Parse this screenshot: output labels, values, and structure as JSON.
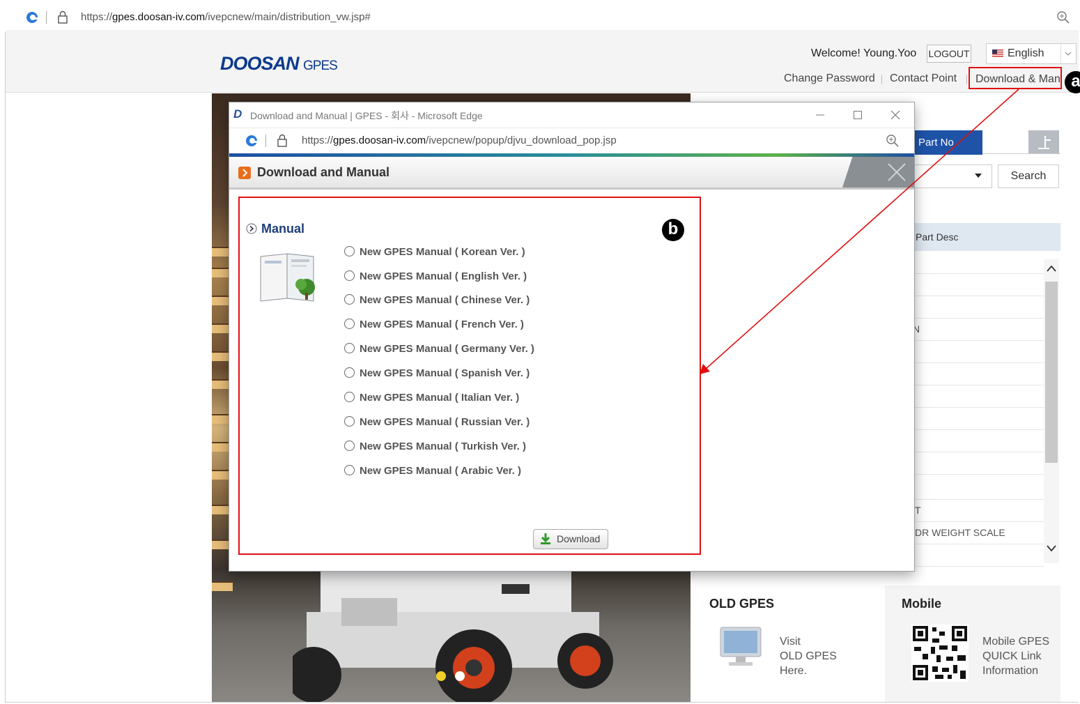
{
  "browser": {
    "url_prefix": "https://",
    "url_host": "gpes.doosan-iv.com",
    "url_path": "/ivepcnew/main/distribution_vw.jsp#"
  },
  "header": {
    "logo_main": "DOOSAN",
    "logo_sub": "GPES",
    "welcome": "Welcome! Young.Yoo",
    "logout": "LOGOUT",
    "language": "English",
    "change_password": "Change Password",
    "contact_point": "Contact Point",
    "download_manual": "Download & Man"
  },
  "right_panel": {
    "tab_part_no": "Part No",
    "search_button": "Search",
    "col_part_desc": "Part Desc",
    "row_fragments": [
      "N",
      "T",
      "DR WEIGHT SCALE"
    ],
    "old_gpes_title": "OLD GPES",
    "old_gpes_text": [
      "Visit",
      "OLD GPES",
      "Here."
    ],
    "mobile_title": "Mobile",
    "mobile_text": [
      "Mobile GPES",
      "QUICK Link",
      "Information"
    ]
  },
  "popup": {
    "window_title": "Download and Manual | GPES - 회사 - Microsoft Edge",
    "url_prefix": "https://",
    "url_host": "gpes.doosan-iv.com",
    "url_path": "/ivepcnew/popup/djvu_download_pop.jsp",
    "heading": "Download and Manual",
    "section_title": "Manual",
    "manuals": [
      "New GPES Manual ( Korean Ver. )",
      "New GPES Manual ( English Ver. )",
      "New GPES Manual ( Chinese Ver. )",
      "New GPES Manual ( French Ver. )",
      "New GPES Manual ( Germany Ver. )",
      "New GPES Manual ( Spanish Ver. )",
      "New GPES Manual ( Italian Ver. )",
      "New GPES Manual ( Russian Ver. )",
      "New GPES Manual ( Turkish Ver. )",
      "New GPES Manual ( Arabic Ver. )"
    ],
    "download_button": "Download"
  },
  "annotations": {
    "marker_a": "a",
    "marker_b": "b",
    "color": "#e01010"
  },
  "icons": [
    "edge-logo-icon",
    "lock-icon",
    "zoom-icon",
    "us-flag-icon",
    "chevron-down-icon",
    "minimize-icon",
    "maximize-icon",
    "close-icon",
    "manual-book-icon",
    "download-arrow-icon",
    "qr-code-icon",
    "monitor-icon",
    "forklift-image"
  ]
}
